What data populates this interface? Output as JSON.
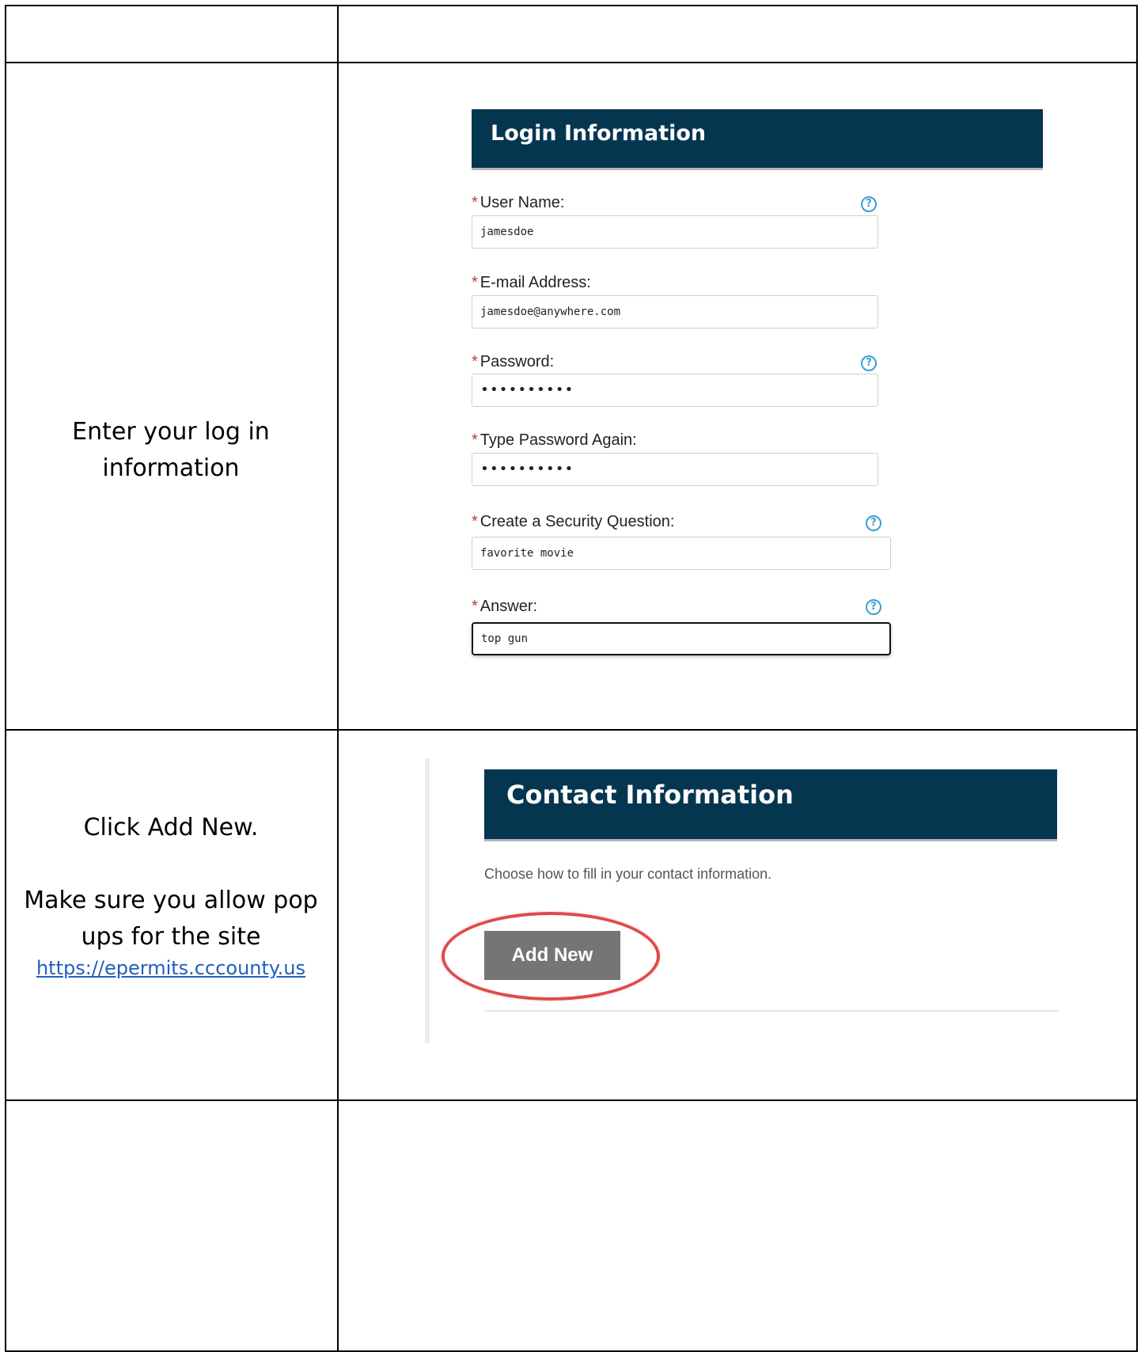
{
  "steps": [
    {
      "instruction": [
        "Enter your log in",
        "information"
      ],
      "screenshot": {
        "header": "Login Information",
        "fields": [
          {
            "label": "User Name:",
            "value": "jamesdoe",
            "required": true,
            "help": true
          },
          {
            "label": "E-mail Address:",
            "value": "jamesdoe@anywhere.com",
            "required": true,
            "help": false
          },
          {
            "label": "Password:",
            "value": "••••••••••",
            "required": true,
            "help": true
          },
          {
            "label": "Type Password Again:",
            "value": "••••••••••",
            "required": true,
            "help": false
          },
          {
            "label": "Create a Security Question:",
            "value": "favorite movie",
            "required": true,
            "help": true
          },
          {
            "label": "Answer:",
            "value": "top gun",
            "required": true,
            "help": true
          }
        ]
      }
    },
    {
      "instruction": [
        "Click Add New.",
        "Make sure you allow pop",
        "ups for the site"
      ],
      "link": "https://epermits.cccounty.us",
      "screenshot": {
        "header": "Contact Information",
        "description": "Choose how to fill in your contact information.",
        "button": "Add New"
      }
    }
  ],
  "required_marker": "*",
  "help_glyph": "?",
  "colors": {
    "header_bg": "#053650",
    "help_icon": "#3b9ed8",
    "highlight": "#e04a4a",
    "button_bg": "#777474",
    "link": "#1f5fbf"
  }
}
